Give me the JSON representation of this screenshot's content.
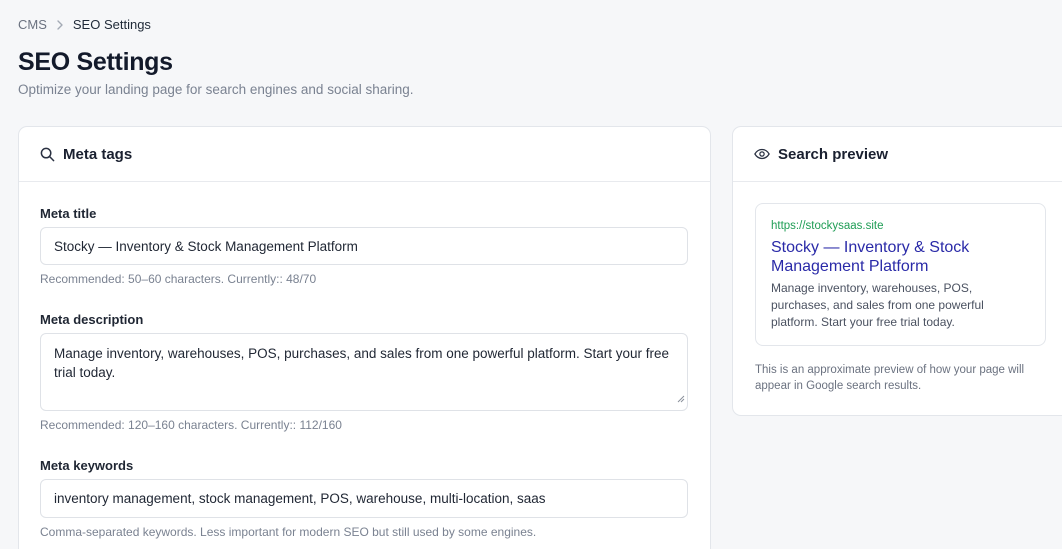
{
  "breadcrumb": {
    "parent": "CMS",
    "current": "SEO Settings"
  },
  "header": {
    "title": "SEO Settings",
    "subtitle": "Optimize your landing page for search engines and social sharing."
  },
  "meta_card": {
    "title": "Meta tags",
    "icon": "search-icon",
    "meta_title": {
      "label": "Meta title",
      "value": "Stocky — Inventory & Stock Management Platform",
      "help": "Recommended: 50–60 characters. Currently:: 48/70"
    },
    "meta_description": {
      "label": "Meta description",
      "value": "Manage inventory, warehouses, POS, purchases, and sales from one powerful platform. Start your free trial today.",
      "help": "Recommended: 120–160 characters. Currently:: 112/160"
    },
    "meta_keywords": {
      "label": "Meta keywords",
      "value": "inventory management, stock management, POS, warehouse, multi-location, saas",
      "help": "Comma-separated keywords. Less important for modern SEO but still used by some engines."
    }
  },
  "preview_card": {
    "title": "Search preview",
    "icon": "eye-icon",
    "url": "https://stockysaas.site",
    "serp_title": "Stocky — Inventory & Stock Management Platform",
    "serp_description": "Manage inventory, warehouses, POS, purchases, and sales from one powerful platform. Start your free trial today.",
    "note": "This is an approximate preview of how your page will appear in Google search results."
  },
  "colors": {
    "background": "#f6f7f9",
    "serp_title": "#2a2aa8",
    "serp_url": "#1f9d55"
  }
}
